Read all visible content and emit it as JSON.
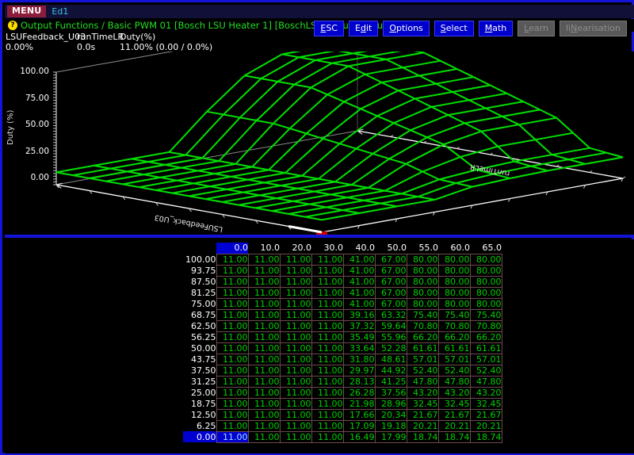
{
  "menubar": {
    "menu_label": "MENU",
    "editor_label": "Ed1"
  },
  "breadcrumb": {
    "help_icon": "help-icon",
    "text": "Output Functions / Basic PWM 01 [Bosch LSU Heater 1] [BoschLSU] / Output Duty"
  },
  "toolbar": {
    "buttons": [
      {
        "label": "ESC",
        "accel": "E",
        "enabled": true
      },
      {
        "label": "Edit",
        "accel": "d",
        "enabled": true
      },
      {
        "label": "Options",
        "accel": "O",
        "enabled": true
      },
      {
        "label": "Select",
        "accel": "S",
        "enabled": true
      },
      {
        "label": "Math",
        "accel": "M",
        "enabled": true
      },
      {
        "label": "Learn",
        "accel": "L",
        "enabled": false
      },
      {
        "label": "liNearisation",
        "accel": "N",
        "enabled": false
      }
    ]
  },
  "status": {
    "col1": {
      "label": "LSUFeedback_U03",
      "value": "0.00%"
    },
    "col2": {
      "label": "runTimeLR",
      "value": "0.0s"
    },
    "col3": {
      "label": "Duty(%)",
      "value": "11.00% (0.00 / 0.0%)"
    }
  },
  "chart_data": {
    "type": "surface",
    "title": "",
    "xlabel": "runTimeLR",
    "ylabel": "Duty (%)",
    "zlabel": "LSUFeedback_U03",
    "zlim": [
      0,
      100
    ],
    "ztick_labels": [
      "100.00",
      "75.00",
      "50.00",
      "25.00",
      "0.00"
    ],
    "ztick_values": [
      100,
      75,
      50,
      25,
      0
    ],
    "grid": true,
    "legend": "none",
    "marker_color": "#cc0000",
    "surface_color": "#00dd00",
    "x": [
      0.0,
      10.0,
      20.0,
      30.0,
      40.0,
      50.0,
      55.0,
      60.0,
      65.0
    ],
    "y": [
      100.0,
      93.75,
      87.5,
      81.25,
      75.0,
      68.75,
      62.5,
      56.25,
      50.0,
      43.75,
      37.5,
      31.25,
      25.0,
      18.75,
      12.5,
      6.25,
      0.0
    ],
    "z": [
      [
        11.0,
        11.0,
        11.0,
        11.0,
        41.0,
        67.0,
        80.0,
        80.0,
        80.0
      ],
      [
        11.0,
        11.0,
        11.0,
        11.0,
        41.0,
        67.0,
        80.0,
        80.0,
        80.0
      ],
      [
        11.0,
        11.0,
        11.0,
        11.0,
        41.0,
        67.0,
        80.0,
        80.0,
        80.0
      ],
      [
        11.0,
        11.0,
        11.0,
        11.0,
        41.0,
        67.0,
        80.0,
        80.0,
        80.0
      ],
      [
        11.0,
        11.0,
        11.0,
        11.0,
        41.0,
        67.0,
        80.0,
        80.0,
        80.0
      ],
      [
        11.0,
        11.0,
        11.0,
        11.0,
        39.16,
        63.32,
        75.4,
        75.4,
        75.4
      ],
      [
        11.0,
        11.0,
        11.0,
        11.0,
        37.32,
        59.64,
        70.8,
        70.8,
        70.8
      ],
      [
        11.0,
        11.0,
        11.0,
        11.0,
        35.49,
        55.96,
        66.2,
        66.2,
        66.2
      ],
      [
        11.0,
        11.0,
        11.0,
        11.0,
        33.64,
        52.28,
        61.61,
        61.61,
        61.61
      ],
      [
        11.0,
        11.0,
        11.0,
        11.0,
        31.8,
        48.61,
        57.01,
        57.01,
        57.01
      ],
      [
        11.0,
        11.0,
        11.0,
        11.0,
        29.97,
        44.92,
        52.4,
        52.4,
        52.4
      ],
      [
        11.0,
        11.0,
        11.0,
        11.0,
        28.13,
        41.25,
        47.8,
        47.8,
        47.8
      ],
      [
        11.0,
        11.0,
        11.0,
        11.0,
        26.28,
        37.56,
        43.2,
        43.2,
        43.2
      ],
      [
        11.0,
        11.0,
        11.0,
        11.0,
        21.98,
        28.96,
        32.45,
        32.45,
        32.45
      ],
      [
        11.0,
        11.0,
        11.0,
        11.0,
        17.66,
        20.34,
        21.67,
        21.67,
        21.67
      ],
      [
        11.0,
        11.0,
        11.0,
        11.0,
        17.09,
        19.18,
        20.21,
        20.21,
        20.21
      ],
      [
        11.0,
        11.0,
        11.0,
        11.0,
        16.49,
        17.99,
        18.74,
        18.74,
        18.74
      ]
    ]
  },
  "table": {
    "columns": [
      "0.0",
      "10.0",
      "20.0",
      "30.0",
      "40.0",
      "50.0",
      "55.0",
      "60.0",
      "65.0"
    ],
    "selected_column_index": 0,
    "selected_row_index": 16,
    "rows": [
      {
        "header": "100.00",
        "values": [
          "11.00",
          "11.00",
          "11.00",
          "11.00",
          "41.00",
          "67.00",
          "80.00",
          "80.00",
          "80.00"
        ]
      },
      {
        "header": "93.75",
        "values": [
          "11.00",
          "11.00",
          "11.00",
          "11.00",
          "41.00",
          "67.00",
          "80.00",
          "80.00",
          "80.00"
        ]
      },
      {
        "header": "87.50",
        "values": [
          "11.00",
          "11.00",
          "11.00",
          "11.00",
          "41.00",
          "67.00",
          "80.00",
          "80.00",
          "80.00"
        ]
      },
      {
        "header": "81.25",
        "values": [
          "11.00",
          "11.00",
          "11.00",
          "11.00",
          "41.00",
          "67.00",
          "80.00",
          "80.00",
          "80.00"
        ]
      },
      {
        "header": "75.00",
        "values": [
          "11.00",
          "11.00",
          "11.00",
          "11.00",
          "41.00",
          "67.00",
          "80.00",
          "80.00",
          "80.00"
        ]
      },
      {
        "header": "68.75",
        "values": [
          "11.00",
          "11.00",
          "11.00",
          "11.00",
          "39.16",
          "63.32",
          "75.40",
          "75.40",
          "75.40"
        ]
      },
      {
        "header": "62.50",
        "values": [
          "11.00",
          "11.00",
          "11.00",
          "11.00",
          "37.32",
          "59.64",
          "70.80",
          "70.80",
          "70.80"
        ]
      },
      {
        "header": "56.25",
        "values": [
          "11.00",
          "11.00",
          "11.00",
          "11.00",
          "35.49",
          "55.96",
          "66.20",
          "66.20",
          "66.20"
        ]
      },
      {
        "header": "50.00",
        "values": [
          "11.00",
          "11.00",
          "11.00",
          "11.00",
          "33.64",
          "52.28",
          "61.61",
          "61.61",
          "61.61"
        ]
      },
      {
        "header": "43.75",
        "values": [
          "11.00",
          "11.00",
          "11.00",
          "11.00",
          "31.80",
          "48.61",
          "57.01",
          "57.01",
          "57.01"
        ]
      },
      {
        "header": "37.50",
        "values": [
          "11.00",
          "11.00",
          "11.00",
          "11.00",
          "29.97",
          "44.92",
          "52.40",
          "52.40",
          "52.40"
        ]
      },
      {
        "header": "31.25",
        "values": [
          "11.00",
          "11.00",
          "11.00",
          "11.00",
          "28.13",
          "41.25",
          "47.80",
          "47.80",
          "47.80"
        ]
      },
      {
        "header": "25.00",
        "values": [
          "11.00",
          "11.00",
          "11.00",
          "11.00",
          "26.28",
          "37.56",
          "43.20",
          "43.20",
          "43.20"
        ]
      },
      {
        "header": "18.75",
        "values": [
          "11.00",
          "11.00",
          "11.00",
          "11.00",
          "21.98",
          "28.96",
          "32.45",
          "32.45",
          "32.45"
        ]
      },
      {
        "header": "12.50",
        "values": [
          "11.00",
          "11.00",
          "11.00",
          "11.00",
          "17.66",
          "20.34",
          "21.67",
          "21.67",
          "21.67"
        ]
      },
      {
        "header": "6.25",
        "values": [
          "11.00",
          "11.00",
          "11.00",
          "11.00",
          "17.09",
          "19.18",
          "20.21",
          "20.21",
          "20.21"
        ]
      },
      {
        "header": "0.00",
        "values": [
          "11.00",
          "11.00",
          "11.00",
          "11.00",
          "16.49",
          "17.99",
          "18.74",
          "18.74",
          "18.74"
        ]
      }
    ]
  }
}
